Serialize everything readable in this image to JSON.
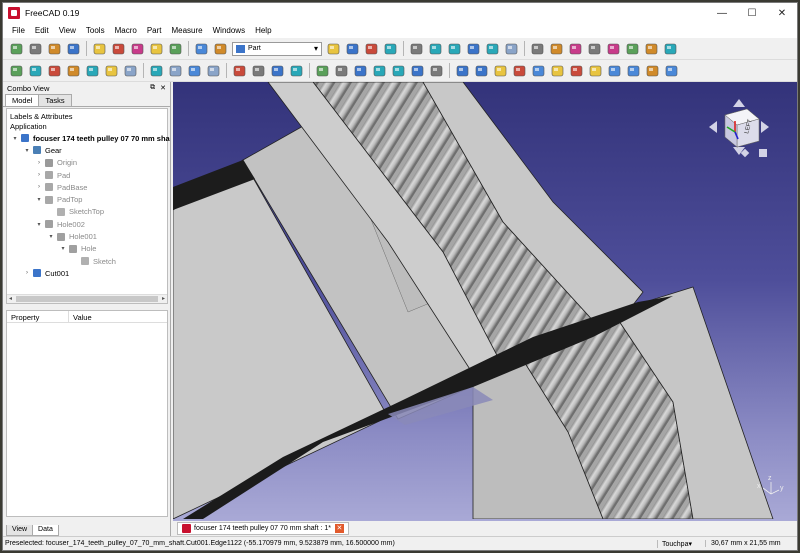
{
  "window": {
    "title": "FreeCAD 0.19",
    "controls": {
      "minimize": "—",
      "maximize": "☐",
      "close": "✕"
    }
  },
  "menubar": [
    "File",
    "Edit",
    "View",
    "Tools",
    "Macro",
    "Part",
    "Measure",
    "Windows",
    "Help"
  ],
  "toolbar": {
    "workbench": "Part",
    "row1_icons": [
      "new-file-icon",
      "open-file-icon",
      "save-icon",
      "save-as-icon",
      "cut-icon",
      "copy-icon",
      "paste-icon",
      "undo-icon",
      "redo-icon",
      "refresh-icon",
      "whats-this-icon",
      "record-macro-icon",
      "stop-macro-icon",
      "edit-macro-icon",
      "run-macro-icon",
      "fit-all-icon",
      "fit-selection-icon",
      "draw-style-icon",
      "bounding-box-icon",
      "back-icon",
      "forward-icon",
      "sync-view-icon",
      "zoom-icon",
      "isometric-view-icon",
      "front-view-icon",
      "top-view-icon",
      "right-view-icon",
      "rear-view-icon",
      "measure-icon"
    ],
    "row2_icons": [
      "sketcher-icon",
      "box-tool-icon",
      "cylinder-tool-icon",
      "sphere-tool-icon",
      "cone-tool-icon",
      "torus-tool-icon",
      "tube-tool-icon",
      "primitives-icon",
      "shape-builder-icon",
      "extrude-icon",
      "revolve-icon",
      "mirror-icon",
      "fillet-icon",
      "chamfer-icon",
      "make-face-icon",
      "ruled-surface-icon",
      "loft-icon",
      "sweep-icon",
      "section-icon",
      "cross-sections-icon",
      "offset-icon",
      "thickness-icon",
      "projection-icon",
      "boolean-icon",
      "cut-icon",
      "fuse-icon",
      "common-icon",
      "join-icon",
      "split-icon",
      "compound-icon",
      "check-geometry-icon",
      "defeaturing-icon",
      "measure-linear-icon",
      "measure-angular-icon"
    ]
  },
  "combo_view": {
    "title": "Combo View",
    "tabs": [
      "Model",
      "Tasks"
    ],
    "labels_header": "Labels & Attributes",
    "application_label": "Application",
    "tree": [
      {
        "label": "focuser 174 teeth pulley 07 70 mm sha",
        "depth": 0,
        "arrow": "▾",
        "icon": "document-icon",
        "style": "bold"
      },
      {
        "label": "Gear",
        "depth": 1,
        "arrow": "▾",
        "icon": "body-icon",
        "style": "normal"
      },
      {
        "label": "Origin",
        "depth": 2,
        "arrow": "›",
        "icon": "origin-icon",
        "style": "dim"
      },
      {
        "label": "Pad",
        "depth": 2,
        "arrow": "›",
        "icon": "pad-icon",
        "style": "dim"
      },
      {
        "label": "PadBase",
        "depth": 2,
        "arrow": "›",
        "icon": "pad-icon",
        "style": "dim"
      },
      {
        "label": "PadTop",
        "depth": 2,
        "arrow": "▾",
        "icon": "pad-icon",
        "style": "dim"
      },
      {
        "label": "SketchTop",
        "depth": 3,
        "arrow": "",
        "icon": "sketch-icon",
        "style": "dim"
      },
      {
        "label": "Hole002",
        "depth": 2,
        "arrow": "▾",
        "icon": "hole-icon",
        "style": "dim"
      },
      {
        "label": "Hole001",
        "depth": 3,
        "arrow": "▾",
        "icon": "hole-icon",
        "style": "dim"
      },
      {
        "label": "Hole",
        "depth": 4,
        "arrow": "▾",
        "icon": "hole-icon",
        "style": "dim"
      },
      {
        "label": "Sketch",
        "depth": 5,
        "arrow": "",
        "icon": "sketch-icon",
        "style": "dim"
      },
      {
        "label": "Cut001",
        "depth": 1,
        "arrow": "›",
        "icon": "cut-icon",
        "style": "normal"
      }
    ],
    "property_columns": [
      "Property",
      "Value"
    ],
    "bottom_tabs": [
      "View",
      "Data"
    ]
  },
  "document_tab": {
    "label": "focuser 174 teeth pulley 07 70 mm shaft : 1*",
    "close": "✕"
  },
  "nav_cube": {
    "face_label": "LEFT"
  },
  "axis_labels": {
    "x": "x",
    "y": "y",
    "z": "z"
  },
  "statusbar": {
    "message": "Preselected: focuser_174_teeth_pulley_07_70_mm_shaft.Cut001.Edge1122 (-55.170979 mm, 9.523879 mm, 16.500000 mm)",
    "navigation": "Touchpa▾",
    "dimensions": "30,67 mm x 21,55 mm"
  },
  "colors": {
    "viewport_top": "#33337a",
    "viewport_bottom": "#a9a9d6",
    "part_gray": "#c8c8c8",
    "teeth_gray": "#a8a8a8",
    "app_red": "#c8102e"
  }
}
